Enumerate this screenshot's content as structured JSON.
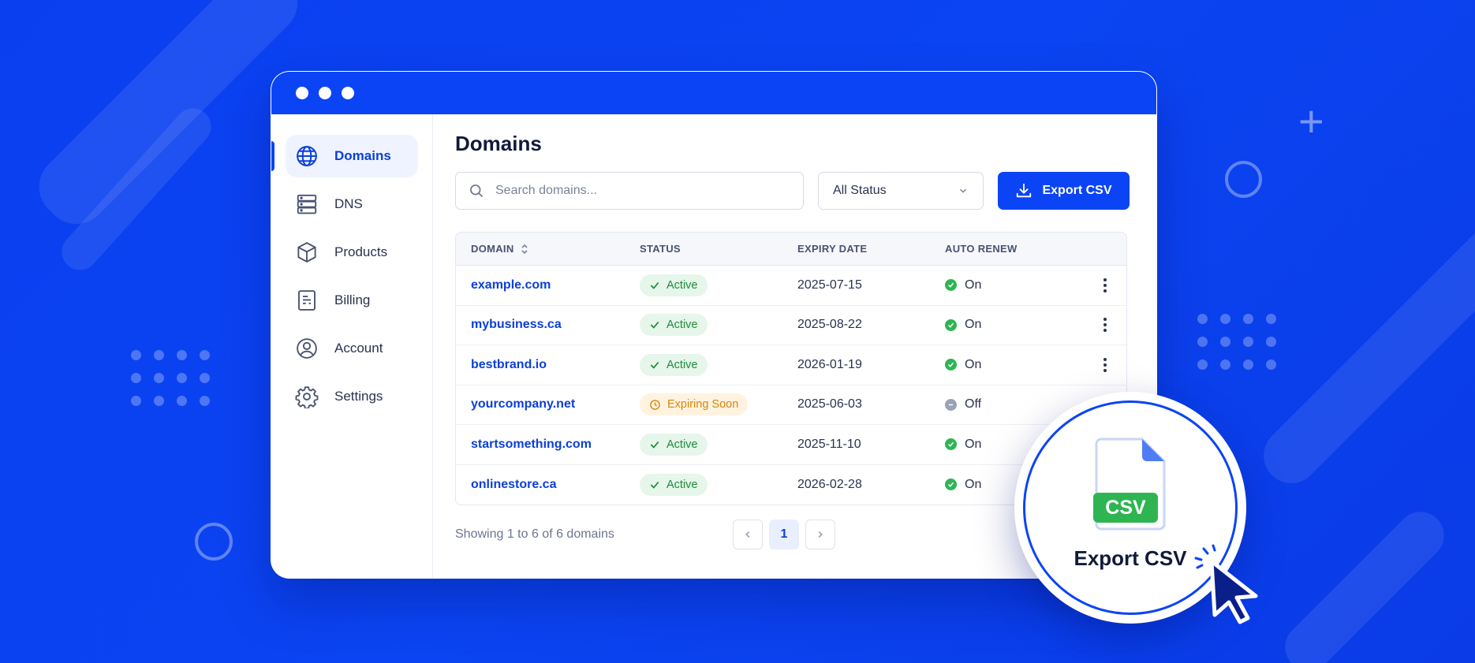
{
  "sidebar": {
    "items": [
      {
        "label": "Domains",
        "icon": "globe-icon",
        "active": true
      },
      {
        "label": "DNS",
        "icon": "server-icon",
        "active": false
      },
      {
        "label": "Products",
        "icon": "box-icon",
        "active": false
      },
      {
        "label": "Billing",
        "icon": "invoice-icon",
        "active": false
      },
      {
        "label": "Account",
        "icon": "user-circle-icon",
        "active": false
      },
      {
        "label": "Settings",
        "icon": "gear-icon",
        "active": false
      }
    ]
  },
  "main": {
    "title": "Domains",
    "search": {
      "placeholder": "Search domains...",
      "value": ""
    },
    "status_filter": {
      "selected": "All Status"
    },
    "export_button": "Export CSV"
  },
  "table": {
    "headers": {
      "domain": "DOMAIN",
      "status": "STATUS",
      "expiry": "EXPIRY DATE",
      "renew": "AUTO RENEW"
    },
    "rows": [
      {
        "domain": "example.com",
        "status": "Active",
        "expiry": "2025-07-15",
        "renew": "On"
      },
      {
        "domain": "mybusiness.ca",
        "status": "Active",
        "expiry": "2025-08-22",
        "renew": "On"
      },
      {
        "domain": "bestbrand.io",
        "status": "Active",
        "expiry": "2026-01-19",
        "renew": "On"
      },
      {
        "domain": "yourcompany.net",
        "status": "Expiring Soon",
        "expiry": "2025-06-03",
        "renew": "Off"
      },
      {
        "domain": "startsomething.com",
        "status": "Active",
        "expiry": "2025-11-10",
        "renew": "On"
      },
      {
        "domain": "onlinestore.ca",
        "status": "Active",
        "expiry": "2026-02-28",
        "renew": "On"
      }
    ]
  },
  "footer": {
    "showing": "Showing 1 to 6 of 6 domains",
    "current_page": "1"
  },
  "callout": {
    "file_badge": "CSV",
    "label": "Export CSV"
  },
  "colors": {
    "brand": "#0b44f5",
    "active": "#2eb552",
    "warning": "#d6860a",
    "background": "#0a3ff0"
  }
}
